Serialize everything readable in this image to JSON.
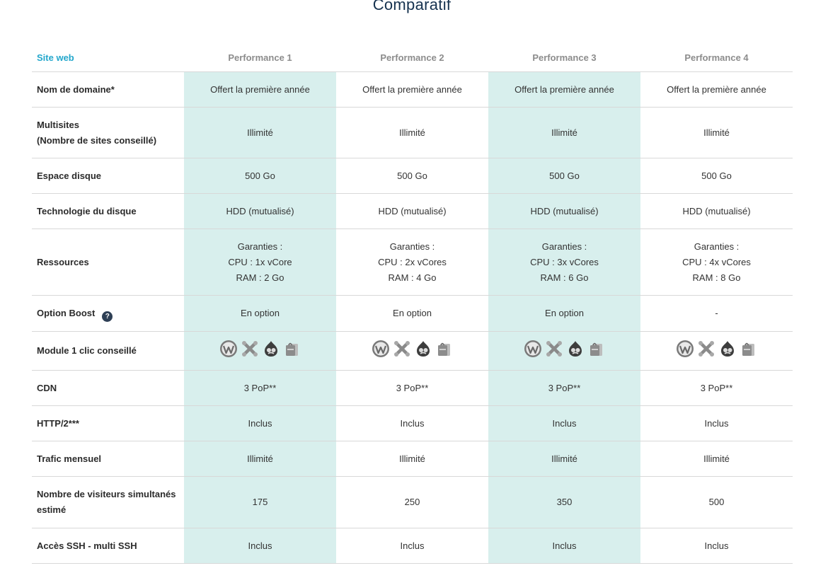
{
  "title": "Comparatif",
  "header": {
    "first": "Site web",
    "plans": [
      "Performance 1",
      "Performance 2",
      "Performance 3",
      "Performance 4"
    ]
  },
  "rows": [
    {
      "label": "Nom de domaine*",
      "values": [
        "Offert la première année",
        "Offert la première année",
        "Offert la première année",
        "Offert la première année"
      ]
    },
    {
      "label_lines": [
        "Multisites",
        "(Nombre de sites conseillé)"
      ],
      "values": [
        "Illimité",
        "Illimité",
        "Illimité",
        "Illimité"
      ]
    },
    {
      "label": "Espace disque",
      "values": [
        "500 Go",
        "500 Go",
        "500 Go",
        "500 Go"
      ]
    },
    {
      "label": "Technologie du disque",
      "values": [
        "HDD (mutualisé)",
        "HDD (mutualisé)",
        "HDD (mutualisé)",
        "HDD (mutualisé)"
      ]
    },
    {
      "label": "Ressources",
      "values": [
        [
          "Garanties :",
          "CPU : 1x vCore",
          "RAM : 2 Go"
        ],
        [
          "Garanties :",
          "CPU : 2x vCores",
          "RAM : 4 Go"
        ],
        [
          "Garanties :",
          "CPU : 3x vCores",
          "RAM : 6 Go"
        ],
        [
          "Garanties :",
          "CPU : 4x vCores",
          "RAM : 8 Go"
        ]
      ]
    },
    {
      "label": "Option Boost",
      "help_icon": "question-icon",
      "help_text": "?",
      "values": [
        "En option",
        "En option",
        "En option",
        "-"
      ]
    },
    {
      "label": "Module 1 clic conseillé",
      "icons": [
        "wordpress-icon",
        "joomla-icon",
        "drupal-icon",
        "prestashop-icon"
      ]
    },
    {
      "label": "CDN",
      "values": [
        "3 PoP**",
        "3 PoP**",
        "3 PoP**",
        "3 PoP**"
      ]
    },
    {
      "label": "HTTP/2***",
      "values": [
        "Inclus",
        "Inclus",
        "Inclus",
        "Inclus"
      ]
    },
    {
      "label": "Trafic mensuel",
      "values": [
        "Illimité",
        "Illimité",
        "Illimité",
        "Illimité"
      ]
    },
    {
      "label_lines": [
        "Nombre de visiteurs simultanés",
        "estimé"
      ],
      "values": [
        "175",
        "250",
        "350",
        "500"
      ]
    },
    {
      "label": "Accès SSH - multi SSH",
      "values": [
        "Inclus",
        "Inclus",
        "Inclus",
        "Inclus"
      ]
    }
  ],
  "colors": {
    "highlight": "#d8efed",
    "accent": "#23a7cc",
    "title": "#16324f"
  }
}
